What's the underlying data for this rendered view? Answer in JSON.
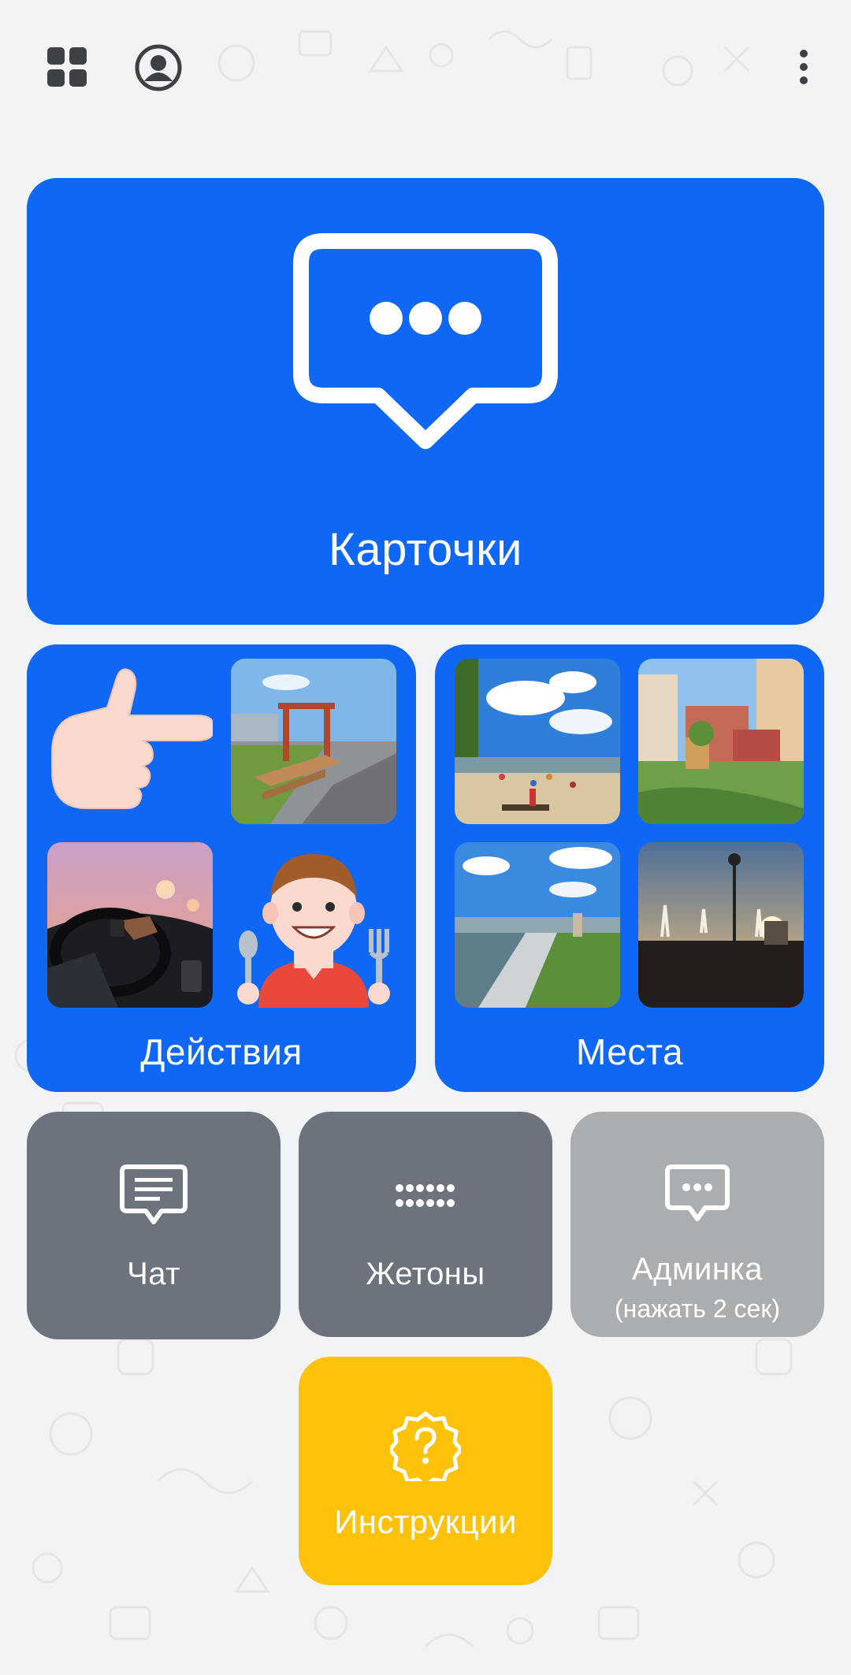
{
  "topbar": {
    "menu_icon": "grid-icon",
    "profile_icon": "user-circle-icon",
    "more_icon": "more-vertical-icon"
  },
  "main_card": {
    "label": "Карточки",
    "icon": "speech-bubble-dots-icon"
  },
  "actions_card": {
    "label": "Действия",
    "tiles": [
      "pointing-hand",
      "park-boardwalk-photo",
      "driving-car-photo",
      "boy-eating-illustration"
    ]
  },
  "places_card": {
    "label": "Места",
    "tiles": [
      "beach-photo",
      "apartment-playground-photo",
      "river-embankment-photo",
      "fountain-sunset-photo"
    ]
  },
  "chat_card": {
    "label": "Чат",
    "icon": "chat-lines-icon"
  },
  "tokens_card": {
    "label": "Жетоны",
    "icon": "dots-grid-icon"
  },
  "admin_card": {
    "label": "Админка",
    "sub": "(нажать 2 сек)",
    "icon": "speech-bubble-dots-icon"
  },
  "instructions_card": {
    "label": "Инструкции",
    "icon": "help-badge-icon"
  },
  "colors": {
    "blue": "#0f67f5",
    "gray": "#6c737c",
    "light_gray": "#abaeb1",
    "yellow": "#fec20a",
    "background": "#f2f3f5"
  }
}
